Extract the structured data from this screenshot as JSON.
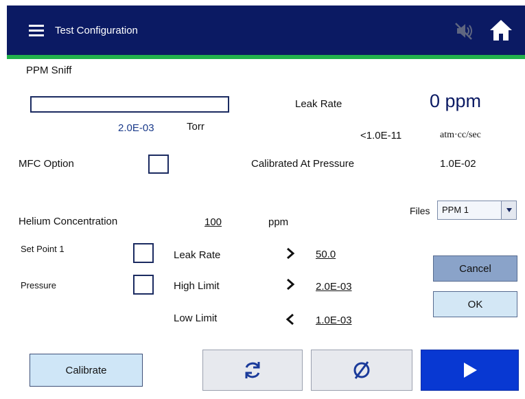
{
  "header": {
    "title": "Test Configuration",
    "menu_icon": "hamburger-menu-icon",
    "mute_icon": "speaker-muted-icon",
    "home_icon": "home-icon"
  },
  "mode": "PPM Sniff",
  "left": {
    "textbox_value": "",
    "pressure_value": "2.0E-03",
    "pressure_unit": "Torr",
    "mfc_label": "MFC Option"
  },
  "right": {
    "leak_rate_label": "Leak Rate",
    "leak_rate_value": "0 ppm",
    "leak_rate_std_value": "<1.0E-11",
    "leak_rate_std_unit": "atm·cc/sec",
    "calibrated_label": "Calibrated At Pressure",
    "calibrated_value": "1.0E-02"
  },
  "helium": {
    "label": "Helium Concentration",
    "value": "100",
    "unit": "ppm"
  },
  "files": {
    "label": "Files",
    "selected": "PPM 1"
  },
  "setpoints": {
    "set_point_label": "Set Point 1",
    "pressure_label": "Pressure",
    "rows": [
      {
        "label": "Leak Rate",
        "operator": "greater-than",
        "value": "50.0"
      },
      {
        "label": "High Limit",
        "operator": "greater-than",
        "value": "2.0E-03"
      },
      {
        "label": "Low Limit",
        "operator": "less-than",
        "value": "1.0E-03"
      }
    ]
  },
  "buttons": {
    "cancel": "Cancel",
    "ok": "OK",
    "calibrate": "Calibrate",
    "refresh_icon": "refresh-icon",
    "zero_icon": "zero-icon",
    "play_icon": "play-icon"
  },
  "colors": {
    "header_bg": "#0b1a63",
    "accent_green": "#22b24c",
    "play_button": "#0838d2",
    "value_blue": "#1a3a8a"
  }
}
